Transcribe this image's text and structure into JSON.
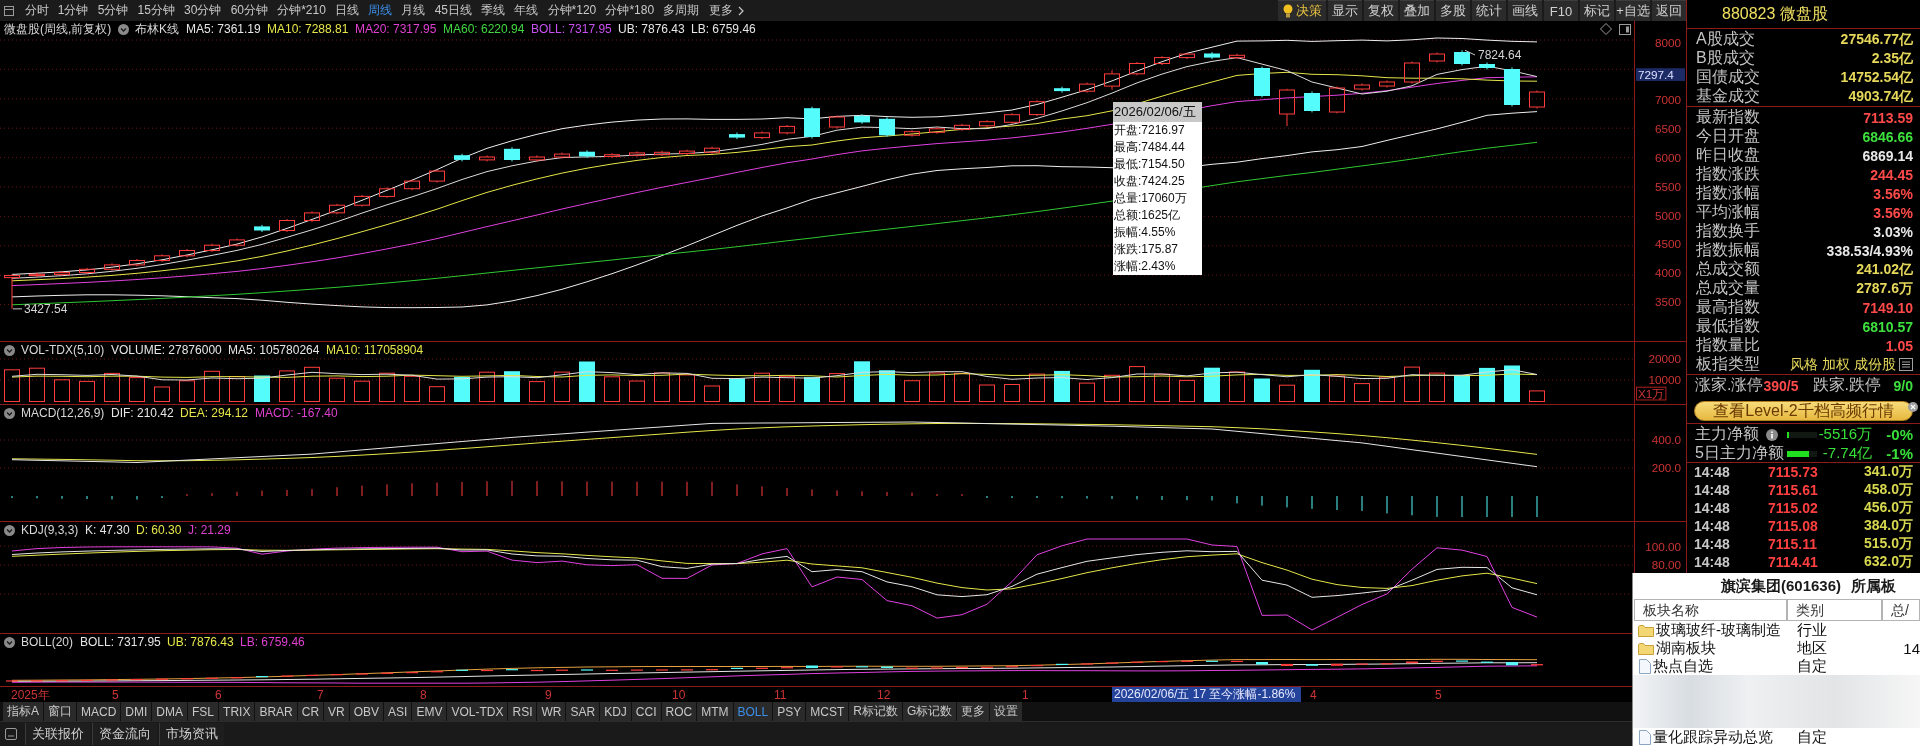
{
  "toolbar": {
    "periods": [
      {
        "label": "分时",
        "selected": false
      },
      {
        "label": "1分钟",
        "selected": false
      },
      {
        "label": "5分钟",
        "selected": false
      },
      {
        "label": "15分钟",
        "selected": false
      },
      {
        "label": "30分钟",
        "selected": false
      },
      {
        "label": "60分钟",
        "selected": false
      },
      {
        "label": "分钟*210",
        "selected": false
      },
      {
        "label": "日线",
        "selected": false
      },
      {
        "label": "周线",
        "selected": true
      },
      {
        "label": "月线",
        "selected": false
      },
      {
        "label": "45日线",
        "selected": false
      },
      {
        "label": "季线",
        "selected": false
      },
      {
        "label": "年线",
        "selected": false
      },
      {
        "label": "分钟*120",
        "selected": false
      },
      {
        "label": "分钟*180",
        "selected": false
      },
      {
        "label": "多周期",
        "selected": false
      }
    ],
    "more": "更多",
    "actions": [
      {
        "label": "决策",
        "kind": "decision"
      },
      {
        "label": "显示",
        "kind": "plain"
      },
      {
        "label": "复权",
        "kind": "plain"
      },
      {
        "label": "叠加",
        "kind": "plain"
      },
      {
        "label": "多股",
        "kind": "plain"
      },
      {
        "label": "统计",
        "kind": "plain"
      },
      {
        "label": "画线",
        "kind": "plain"
      },
      {
        "label": "F10",
        "kind": "plain"
      },
      {
        "label": "标记",
        "kind": "plain"
      },
      {
        "label": "+自选",
        "kind": "plain"
      },
      {
        "label": "返回",
        "kind": "plain"
      }
    ]
  },
  "main_chart": {
    "title": "微盘股(周线,前复权)",
    "indicator": "布林K线",
    "values": [
      {
        "text": "MA5: 7361.19",
        "color": "#e6e6e6"
      },
      {
        "text": "MA10: 7288.81",
        "color": "#e6e64a"
      },
      {
        "text": "MA20: 7317.95",
        "color": "#e040d0"
      },
      {
        "text": "MA60: 6220.94",
        "color": "#40d840"
      },
      {
        "text": "BOLL: 7317.95",
        "color": "#c850f0"
      },
      {
        "text": "UB: 7876.43",
        "color": "#e6e6e6"
      },
      {
        "text": "LB: 6759.46",
        "color": "#e6e6e6"
      }
    ],
    "y_labels": [
      "8000",
      "7000",
      "6500",
      "6000",
      "5500",
      "5000",
      "4500",
      "4000",
      "3500"
    ],
    "price_marker": "7297.4",
    "high_label": "7824.64",
    "low_label": "3427.54",
    "tooltip": {
      "title": "2026/02/06/五",
      "lines": [
        "开盘:7216.97",
        "最高:7484.44",
        "最低:7154.50",
        "收盘:7424.25",
        "总量:17060万",
        "总额:1625亿",
        "振幅:4.55%",
        "涨跌:175.87",
        "涨幅:2.43%"
      ]
    }
  },
  "panels": [
    {
      "kind": "volume",
      "title": "VOL-TDX(5,10)",
      "values": [
        {
          "text": "VOLUME: 27876000",
          "color": "#e6e6e6"
        },
        {
          "text": "MA5: 105780264",
          "color": "#e6e6e6"
        },
        {
          "text": "MA10: 117058904",
          "color": "#e6e64a"
        }
      ],
      "y_labels": [
        "20000",
        "10000",
        "X1万"
      ]
    },
    {
      "kind": "macd",
      "title": "MACD(12,26,9)",
      "values": [
        {
          "text": "DIF: 210.42",
          "color": "#e6e6e6"
        },
        {
          "text": "DEA: 294.12",
          "color": "#e6e64a"
        },
        {
          "text": "MACD: -167.40",
          "color": "#e040d0"
        }
      ],
      "y_labels": [
        "400.0",
        "200.0"
      ]
    },
    {
      "kind": "kdj",
      "title": "KDJ(9,3,3)",
      "values": [
        {
          "text": "K: 47.30",
          "color": "#e6e6e6"
        },
        {
          "text": "D: 60.30",
          "color": "#e6e64a"
        },
        {
          "text": "J: 21.29",
          "color": "#e040d0"
        }
      ],
      "y_labels": [
        "100.00",
        "80.00"
      ]
    },
    {
      "kind": "boll",
      "title": "BOLL(20)",
      "values": [
        {
          "text": "BOLL: 7317.95",
          "color": "#e6e6e6"
        },
        {
          "text": "UB: 7876.43",
          "color": "#e6e64a"
        },
        {
          "text": "LB: 6759.46",
          "color": "#e040d0"
        }
      ]
    }
  ],
  "date_axis": {
    "labels": [
      "2025年",
      "5",
      "6",
      "7",
      "8",
      "9",
      "10",
      "11",
      "12",
      "1",
      "4",
      "5"
    ],
    "cursor_label": "2026/02/06/五 17 至今涨幅-1.86%"
  },
  "indicator_tabs": [
    {
      "label": "指标A",
      "selected": false
    },
    {
      "label": "窗口",
      "selected": false
    },
    {
      "label": "MACD",
      "selected": false
    },
    {
      "label": "DMI",
      "selected": false
    },
    {
      "label": "DMA",
      "selected": false
    },
    {
      "label": "FSL",
      "selected": false
    },
    {
      "label": "TRIX",
      "selected": false
    },
    {
      "label": "BRAR",
      "selected": false
    },
    {
      "label": "CR",
      "selected": false
    },
    {
      "label": "VR",
      "selected": false
    },
    {
      "label": "OBV",
      "selected": false
    },
    {
      "label": "ASI",
      "selected": false
    },
    {
      "label": "EMV",
      "selected": false
    },
    {
      "label": "VOL-TDX",
      "selected": false
    },
    {
      "label": "RSI",
      "selected": false
    },
    {
      "label": "WR",
      "selected": false
    },
    {
      "label": "SAR",
      "selected": false
    },
    {
      "label": "KDJ",
      "selected": false
    },
    {
      "label": "CCI",
      "selected": false
    },
    {
      "label": "ROC",
      "selected": false
    },
    {
      "label": "MTM",
      "selected": false
    },
    {
      "label": "BOLL",
      "selected": true
    },
    {
      "label": "PSY",
      "selected": false
    },
    {
      "label": "MCST",
      "selected": false
    },
    {
      "label": "R标记数",
      "selected": false
    },
    {
      "label": "G标记数",
      "selected": false
    },
    {
      "label": "更多",
      "selected": false
    },
    {
      "label": "设置",
      "selected": false
    }
  ],
  "bottom_tabs": [
    "关联报价",
    "资金流向",
    "市场资讯"
  ],
  "quote_panel": {
    "title": "880823 微盘股",
    "market_rows": [
      {
        "label": "A股成交",
        "value": "27546.77亿"
      },
      {
        "label": "B股成交",
        "value": "2.35亿"
      },
      {
        "label": "国债成交",
        "value": "14752.54亿"
      },
      {
        "label": "基金成交",
        "value": "4903.74亿"
      }
    ],
    "index_rows": [
      {
        "label": "最新指数",
        "value": "7113.59",
        "color": "#ff4a4a"
      },
      {
        "label": "今日开盘",
        "value": "6846.66",
        "color": "#3ee03e"
      },
      {
        "label": "昨日收盘",
        "value": "6869.14",
        "color": "#e8e8e8"
      },
      {
        "label": "指数涨跌",
        "value": "244.45",
        "color": "#ff4a4a"
      },
      {
        "label": "指数涨幅",
        "value": "3.56%",
        "color": "#ff4a4a"
      },
      {
        "label": "平均涨幅",
        "value": "3.56%",
        "color": "#ff4a4a"
      },
      {
        "label": "指数换手",
        "value": "3.03%",
        "color": "#e8e8e8"
      },
      {
        "label": "指数振幅",
        "value": "338.53/4.93%",
        "color": "#e8e8e8"
      },
      {
        "label": "总成交额",
        "value": "241.02亿",
        "color": "#e6d85a"
      },
      {
        "label": "总成交量",
        "value": "2787.6万",
        "color": "#e6d85a"
      },
      {
        "label": "最高指数",
        "value": "7149.10",
        "color": "#ff4a4a"
      },
      {
        "label": "最低指数",
        "value": "6810.57",
        "color": "#3ee03e"
      },
      {
        "label": "指数量比",
        "value": "1.05",
        "color": "#ff4a4a"
      }
    ],
    "board_type": {
      "label": "板指类型",
      "value": "风格 加权 成份股"
    },
    "breadth": [
      {
        "label": "涨家.涨停",
        "value": "390/5",
        "color": "#ff4a4a"
      },
      {
        "label": "跌家.跌停",
        "value": "9/0",
        "color": "#3ee03e"
      }
    ],
    "level2_button": "查看Level-2千档高频行情",
    "flows": [
      {
        "label": "主力净额",
        "info_icon": true,
        "level": 0.05,
        "amount": "-5516万",
        "percent": "-0%"
      },
      {
        "label": "5日主力净额",
        "info_icon": false,
        "level": 0.73,
        "amount": "-7.74亿",
        "percent": "-1%"
      }
    ],
    "ticks": [
      {
        "time": "14:48",
        "price": "7115.73",
        "volume": "341.0万"
      },
      {
        "time": "14:48",
        "price": "7115.61",
        "volume": "458.0万"
      },
      {
        "time": "14:48",
        "price": "7115.02",
        "volume": "456.0万"
      },
      {
        "time": "14:48",
        "price": "7115.08",
        "volume": "384.0万"
      },
      {
        "time": "14:48",
        "price": "7115.11",
        "volume": "515.0万"
      },
      {
        "time": "14:48",
        "price": "7114.41",
        "volume": "632.0万"
      }
    ]
  },
  "sector_popup": {
    "title": "旗滨集团(601636)",
    "subtitle": "所属板",
    "columns": [
      "板块名称",
      "类别",
      "总/"
    ],
    "rows": [
      {
        "kind": "folder",
        "name": "玻璃玻纤-玻璃制造",
        "category": "行业"
      },
      {
        "kind": "folder",
        "name": "湖南板块",
        "category": "地区",
        "column_3": "14"
      },
      {
        "kind": "document",
        "name": "热点自选",
        "category": "自定"
      },
      {
        "kind": "blurred"
      },
      {
        "kind": "document",
        "name": "量化跟踪异动总览",
        "category": "自定"
      }
    ]
  }
}
